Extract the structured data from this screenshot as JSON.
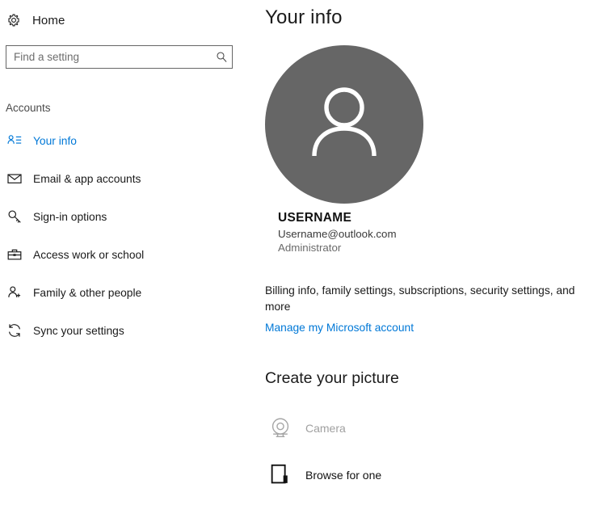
{
  "nav": {
    "home_label": "Home",
    "home_icon": "gear-icon",
    "search": {
      "placeholder": "Find a setting",
      "value": "",
      "icon": "search-icon"
    },
    "section_label": "Accounts",
    "accent_color": "#0078d7",
    "items": [
      {
        "label": "Your info",
        "icon": "contact-card-icon",
        "selected": true
      },
      {
        "label": "Email & app accounts",
        "icon": "envelope-icon",
        "selected": false
      },
      {
        "label": "Sign-in options",
        "icon": "key-icon",
        "selected": false
      },
      {
        "label": "Access work or school",
        "icon": "briefcase-icon",
        "selected": false
      },
      {
        "label": "Family & other people",
        "icon": "person-add-icon",
        "selected": false
      },
      {
        "label": "Sync your settings",
        "icon": "sync-icon",
        "selected": false
      }
    ]
  },
  "main": {
    "title": "Your info",
    "avatar": {
      "icon": "person-avatar-icon",
      "background_color": "#666666"
    },
    "identity": {
      "name": "USERNAME",
      "email": "Username@outlook.com",
      "role": "Administrator"
    },
    "billing_text": "Billing info, family settings, subscriptions, security settings, and more",
    "manage_link": "Manage my Microsoft account",
    "picture_section": {
      "heading": "Create your picture",
      "options": [
        {
          "label": "Camera",
          "icon": "webcam-icon",
          "disabled": true
        },
        {
          "label": "Browse for one",
          "icon": "picture-icon",
          "disabled": false
        }
      ]
    }
  }
}
